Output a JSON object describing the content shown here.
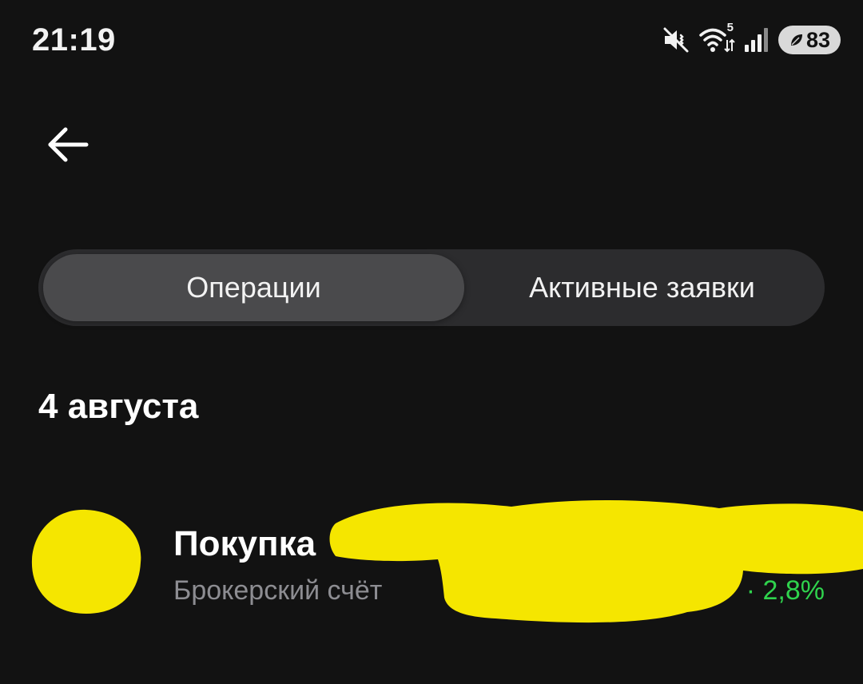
{
  "status_bar": {
    "time": "21:19",
    "icons": [
      "muted-icon",
      "wifi-icon",
      "signal-icon",
      "battery-icon"
    ],
    "wifi_badge": "5",
    "battery_level": "83"
  },
  "header": {
    "back_icon": "arrow-left-icon"
  },
  "segmented_control": {
    "tabs": [
      {
        "label": "Операции",
        "active": true
      },
      {
        "label": "Активные заявки",
        "active": false
      }
    ]
  },
  "operations": {
    "groups": [
      {
        "date": "4 августа",
        "items": [
          {
            "title": "Покупка",
            "subtitle": "Брокерский счёт",
            "change": "· 2,8%"
          }
        ]
      }
    ]
  },
  "colors": {
    "background": "#121212",
    "segmented_bg": "#2c2c2e",
    "segmented_active": "#4a4a4c",
    "secondary_text": "#8d8d92",
    "positive": "#2fd34d",
    "redaction": "#f5e600"
  }
}
